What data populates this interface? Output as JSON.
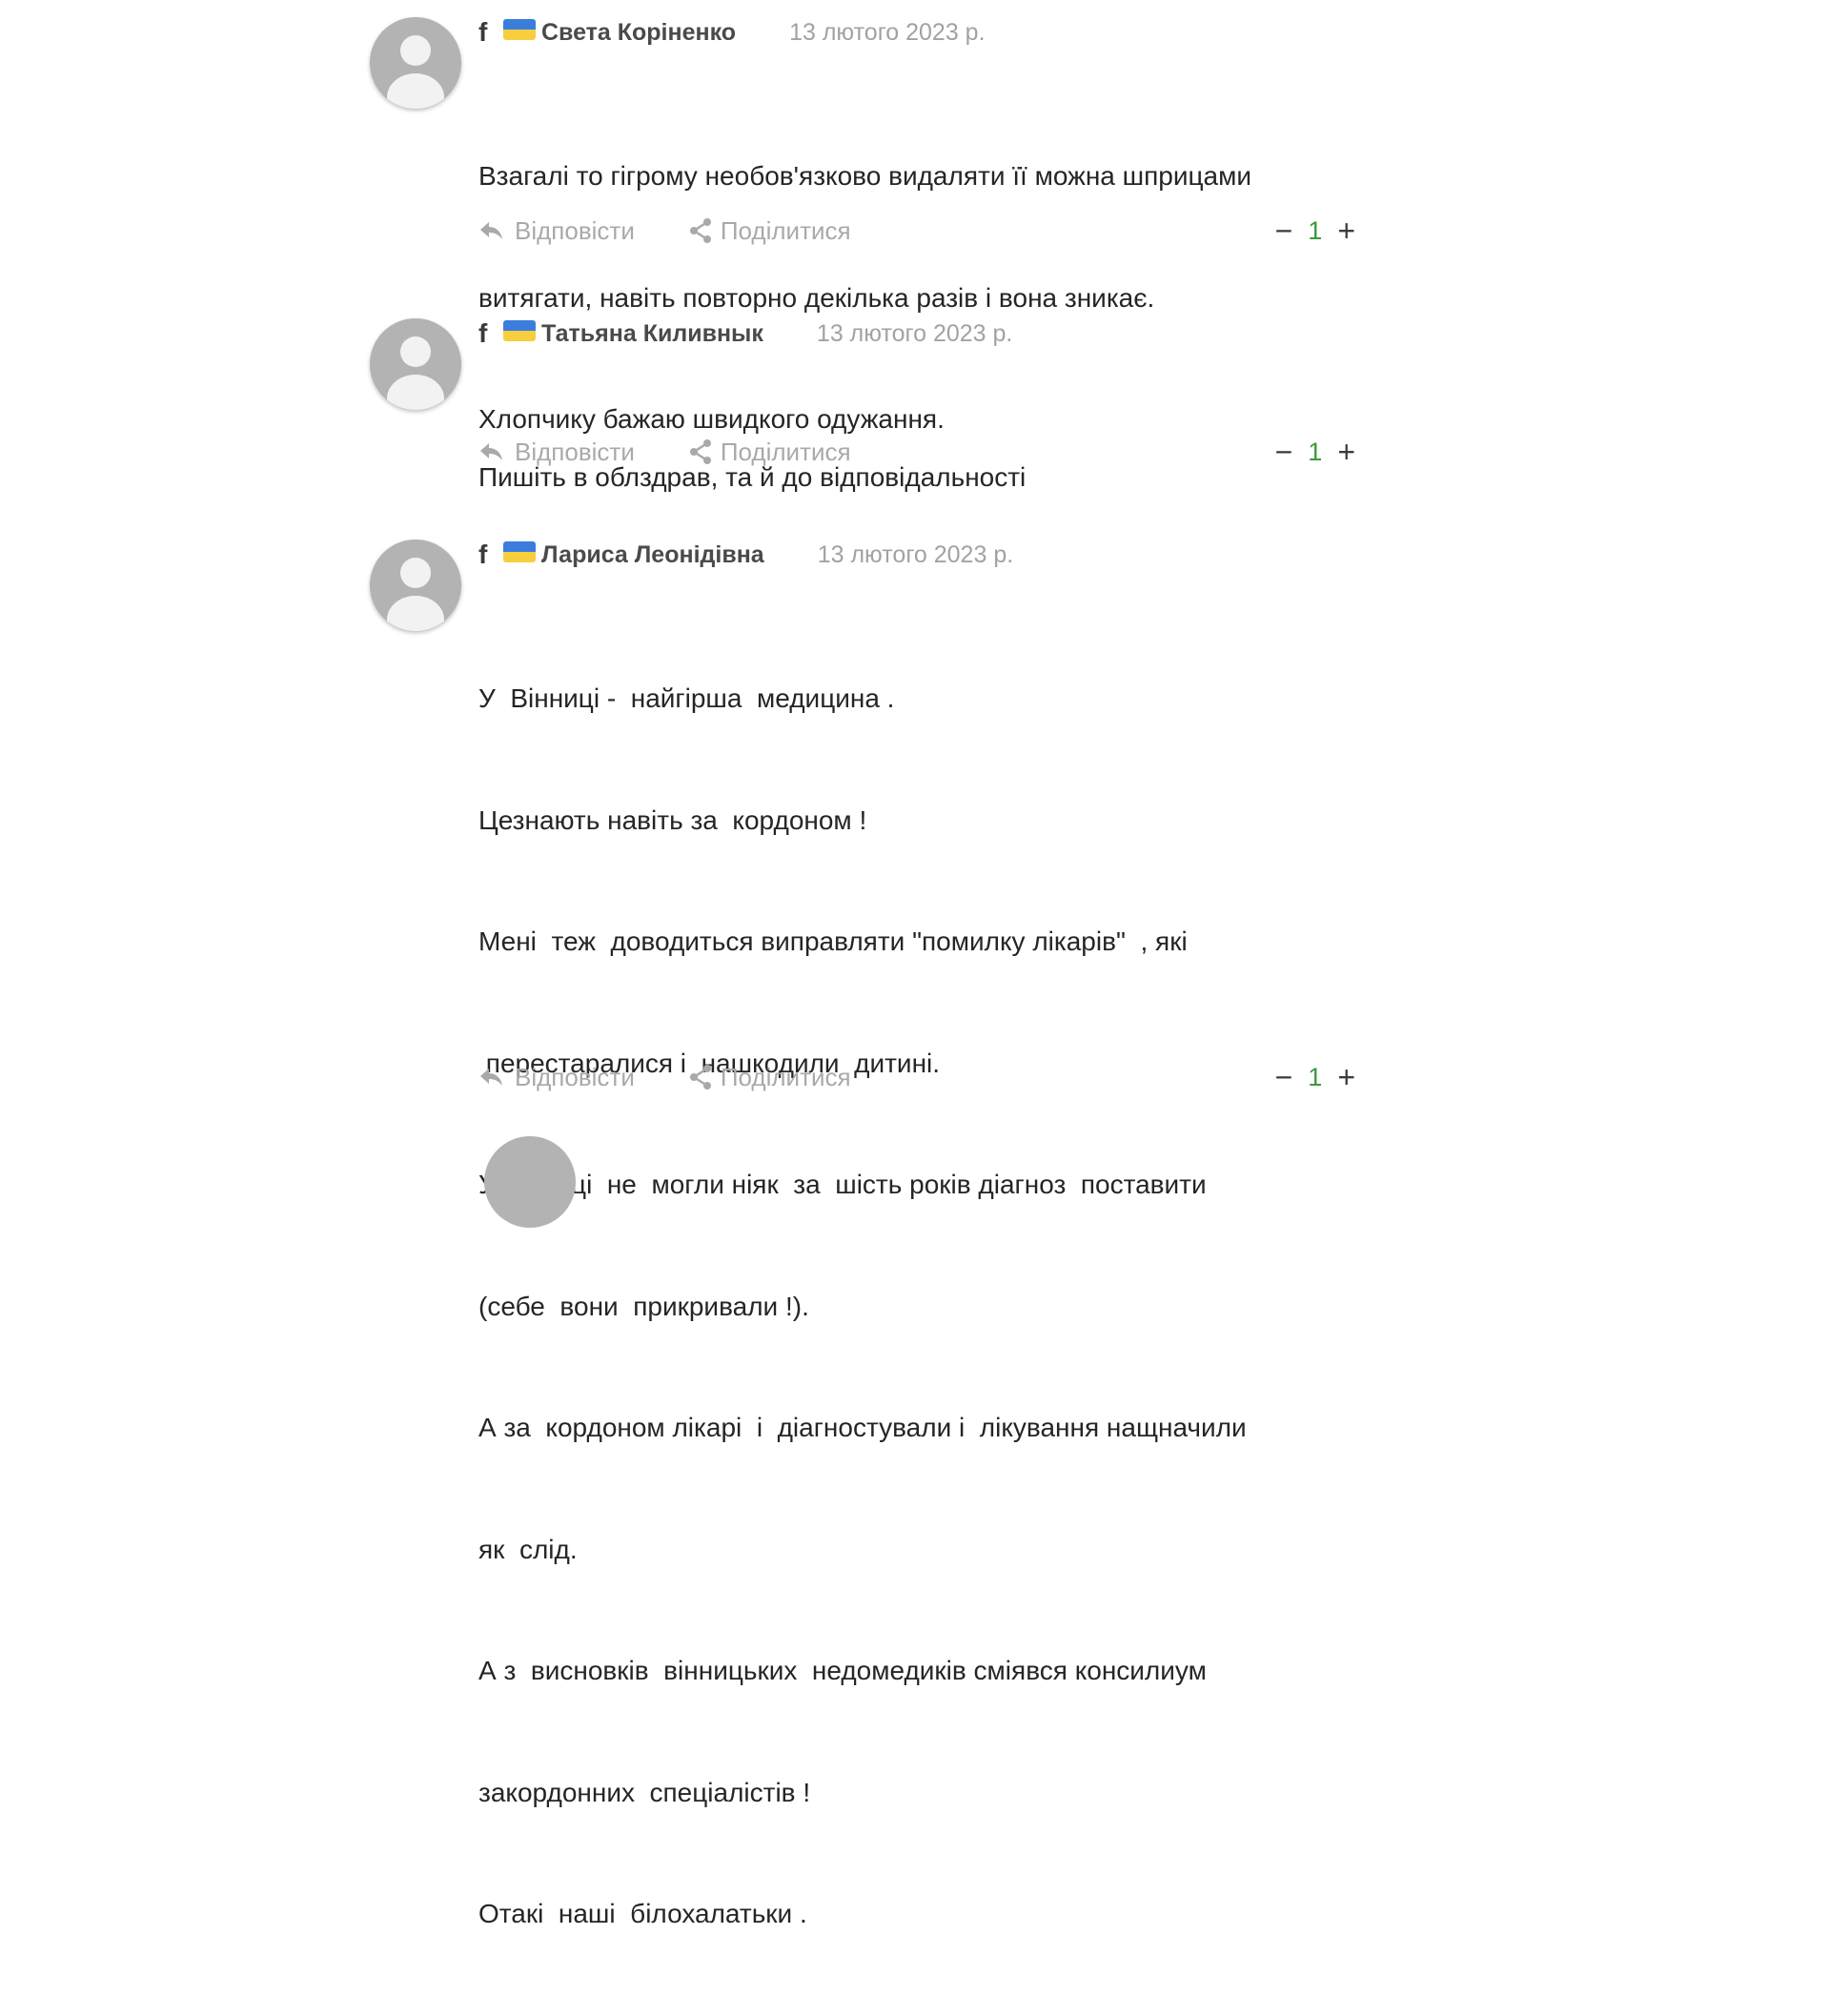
{
  "colors": {
    "avatar": "#b3b3b3",
    "date": "#a2a2a2",
    "action": "#a9a9a9",
    "vote_count": "#3c9a3c",
    "flag_blue": "#3b7ddd",
    "flag_yellow": "#f7ce3e"
  },
  "icons": {
    "platform": "facebook-icon",
    "flag": "ukraine-flag-icon",
    "reply": "reply-arrow-icon",
    "share": "share-icon",
    "avatar": "default-user-avatar-icon"
  },
  "labels": {
    "fb_glyph": "f",
    "reply": "Відповісти",
    "share": "Поділитися",
    "minus": "−",
    "plus": "+"
  },
  "comments": [
    {
      "author": "Света Коріненко",
      "date": "13 лютого 2023 р.",
      "lines": [
        "Взагалі то гігрому необов'язково видаляти її можна шприцами",
        "витягати, навіть повторно декілька разів і вона зникає.",
        "Хлопчику бажаю швидкого одужання."
      ],
      "votes": "1"
    },
    {
      "author": "Татьяна Киливнык",
      "date": "13 лютого 2023 р.",
      "lines": [
        "Пишіть в облздрав, та й до відповідальності"
      ],
      "votes": "1"
    },
    {
      "author": "Лариса Леонідівна",
      "date": "13 лютого 2023 р.",
      "lines": [
        "У  Вінниці -  найгірша  медицина .",
        "Цезнають навіть за  кордоном !",
        "Мені  теж  доводиться виправляти \"помилку лікарів\"  , які",
        " перестаралися і  нашкодили  дитині.",
        "У Вінниці  не  могли ніяк  за  шість років діагноз  поставити",
        "(себе  вони  прикривали !).",
        "А за  кордоном лікарі  і  діагностували і  лікування нащначили",
        "як  слід.",
        "А з  висновків  вінницьких  недомедиків сміявся консилиум",
        "закордонних  спеціалістів !",
        "Отакі  наші  білохалатьки ."
      ],
      "votes": "1"
    }
  ]
}
